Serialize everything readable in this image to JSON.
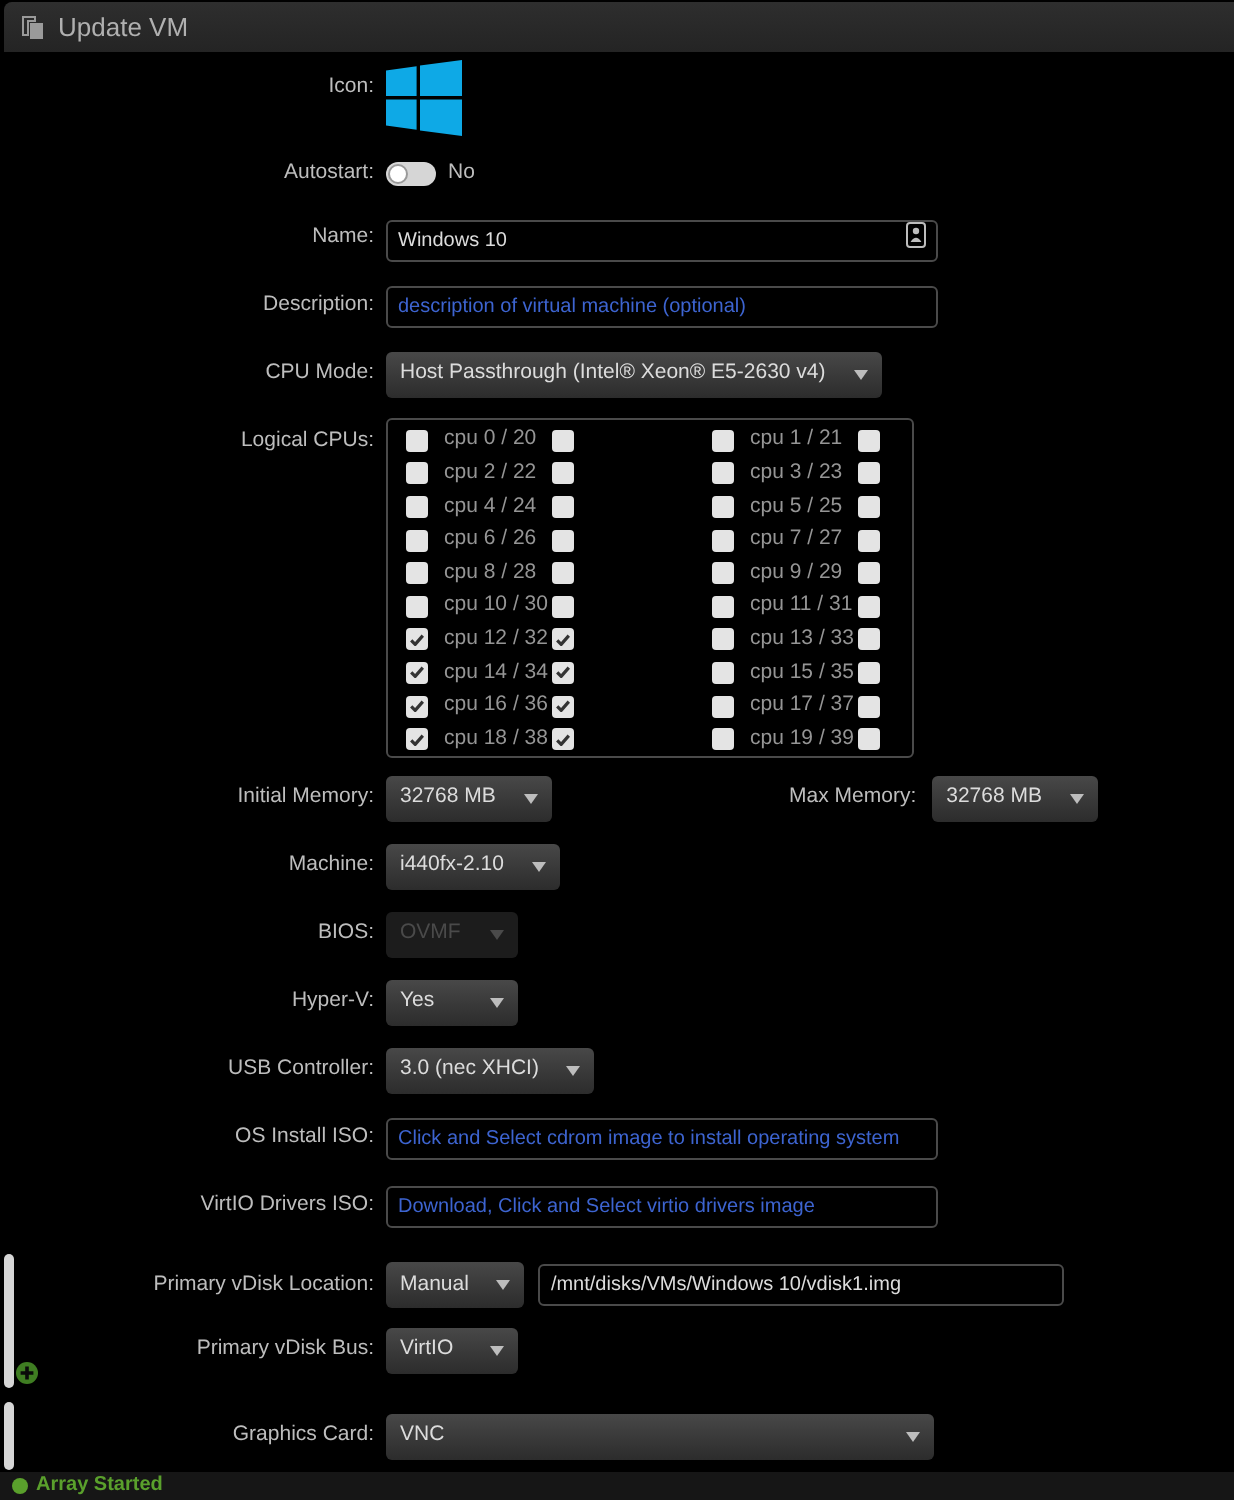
{
  "window": {
    "title": "Update VM"
  },
  "sections": [
    {
      "kind": "plain",
      "rows": [
        {
          "kind": "icon",
          "label": "Icon:"
        },
        {
          "kind": "toggle",
          "label": "Autostart:",
          "on": false,
          "state_text": "No"
        },
        {
          "kind": "input_icon",
          "label": "Name:",
          "value": "Windows 10"
        },
        {
          "kind": "input",
          "label": "Description:",
          "placeholder": "description of virtual machine (optional)"
        },
        {
          "kind": "select",
          "label": "CPU Mode:",
          "value": "Host Passthrough (Intel® Xeon® E5-2630 v4)",
          "disabled": false
        },
        {
          "kind": "cpu_grid",
          "label": "Logical CPUs:",
          "cpus": [
            {
              "label": "cpu 0 / 20",
              "boxes": [
                {
                  "checked": false
                },
                {
                  "checked": false
                }
              ]
            },
            {
              "label": "cpu 1 / 21",
              "boxes": [
                {
                  "checked": false
                },
                {
                  "checked": false
                }
              ]
            },
            {
              "label": "cpu 2 / 22",
              "boxes": [
                {
                  "checked": false
                },
                {
                  "checked": false
                }
              ]
            },
            {
              "label": "cpu 3 / 23",
              "boxes": [
                {
                  "checked": false
                },
                {
                  "checked": false
                }
              ]
            },
            {
              "label": "cpu 4 / 24",
              "boxes": [
                {
                  "checked": false
                },
                {
                  "checked": false
                }
              ]
            },
            {
              "label": "cpu 5 / 25",
              "boxes": [
                {
                  "checked": false
                },
                {
                  "checked": false
                }
              ]
            },
            {
              "label": "cpu 6 / 26",
              "boxes": [
                {
                  "checked": false
                },
                {
                  "checked": false
                }
              ]
            },
            {
              "label": "cpu 7 / 27",
              "boxes": [
                {
                  "checked": false
                },
                {
                  "checked": false
                }
              ]
            },
            {
              "label": "cpu 8 / 28",
              "boxes": [
                {
                  "checked": false
                },
                {
                  "checked": false
                }
              ]
            },
            {
              "label": "cpu 9 / 29",
              "boxes": [
                {
                  "checked": false
                },
                {
                  "checked": false
                }
              ]
            },
            {
              "label": "cpu 10 / 30",
              "boxes": [
                {
                  "checked": false
                },
                {
                  "checked": false
                }
              ]
            },
            {
              "label": "cpu 11 / 31",
              "boxes": [
                {
                  "checked": false
                },
                {
                  "checked": false
                }
              ]
            },
            {
              "label": "cpu 12 / 32",
              "boxes": [
                {
                  "checked": true
                },
                {
                  "checked": true
                }
              ]
            },
            {
              "label": "cpu 13 / 33",
              "boxes": [
                {
                  "checked": false
                },
                {
                  "checked": false
                }
              ]
            },
            {
              "label": "cpu 14 / 34",
              "boxes": [
                {
                  "checked": true
                },
                {
                  "checked": true
                }
              ]
            },
            {
              "label": "cpu 15 / 35",
              "boxes": [
                {
                  "checked": false
                },
                {
                  "checked": false
                }
              ]
            },
            {
              "label": "cpu 16 / 36",
              "boxes": [
                {
                  "checked": true
                },
                {
                  "checked": true
                }
              ]
            },
            {
              "label": "cpu 17 / 37",
              "boxes": [
                {
                  "checked": false
                },
                {
                  "checked": false
                }
              ]
            },
            {
              "label": "cpu 18 / 38",
              "boxes": [
                {
                  "checked": true
                },
                {
                  "checked": true
                }
              ]
            },
            {
              "label": "cpu 19 / 39",
              "boxes": [
                {
                  "checked": false
                },
                {
                  "checked": false
                }
              ]
            }
          ]
        },
        {
          "kind": "select_pair",
          "label": "Initial Memory:",
          "value": "32768 MB",
          "disabled": false,
          "second": {
            "label": "Max Memory:",
            "value": "32768 MB",
            "disabled": false
          }
        },
        {
          "kind": "select",
          "label": "Machine:",
          "value": "i440fx-2.10",
          "disabled": false
        },
        {
          "kind": "select",
          "label": "BIOS:",
          "value": "OVMF",
          "disabled": true
        },
        {
          "kind": "select",
          "label": "Hyper-V:",
          "value": "Yes",
          "disabled": false
        },
        {
          "kind": "select",
          "label": "USB Controller:",
          "value": "3.0 (nec XHCI)",
          "disabled": false
        },
        {
          "kind": "input",
          "label": "OS Install ISO:",
          "placeholder": "Click and Select cdrom image to install operating system"
        },
        {
          "kind": "input",
          "label": "VirtIO Drivers ISO:",
          "placeholder": "Download, Click and Select virtio drivers image"
        }
      ]
    },
    {
      "kind": "disk",
      "rows": [
        {
          "kind": "select_input",
          "label": "Primary vDisk Location:",
          "value": "Manual",
          "disabled": false,
          "path": "/mnt/disks/VMs/Windows 10/vdisk1.img"
        },
        {
          "kind": "select",
          "label": "Primary vDisk Bus:",
          "value": "VirtIO",
          "disabled": false
        }
      ]
    },
    {
      "kind": "graphics",
      "rows": [
        {
          "kind": "select_wide",
          "label": "Graphics Card:",
          "value": "VNC",
          "disabled": false
        }
      ]
    }
  ],
  "status_bar": {
    "text": "Array Started"
  }
}
